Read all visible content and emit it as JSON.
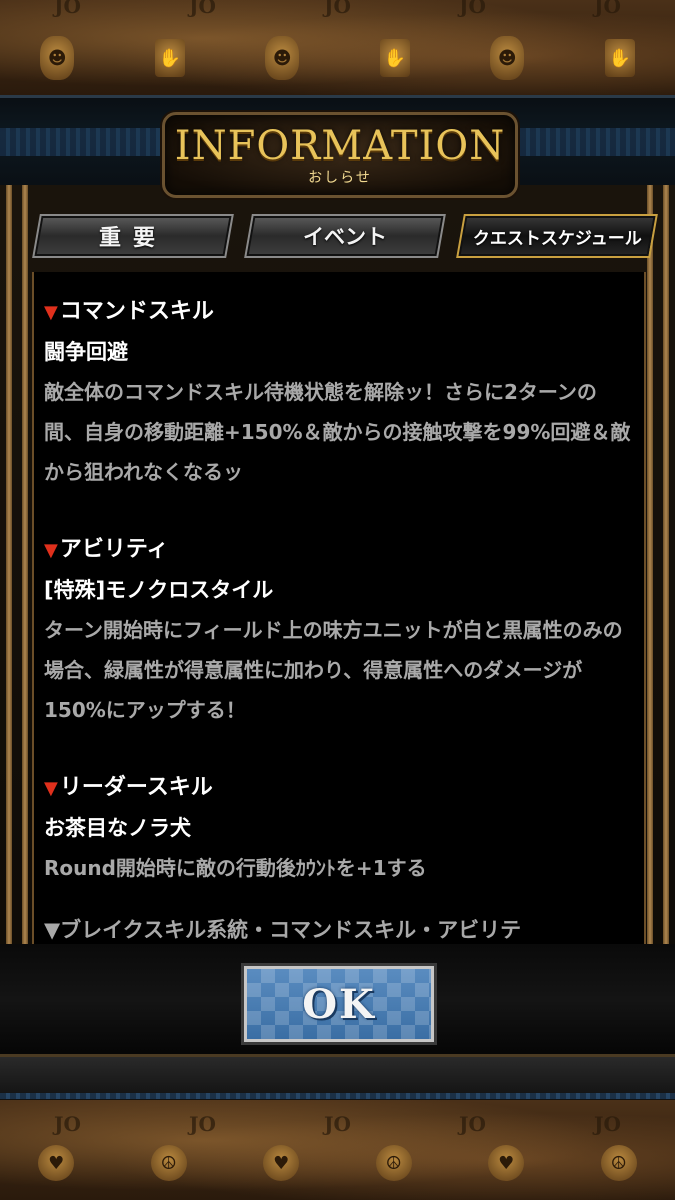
{
  "header": {
    "title": "INFORMATION",
    "subtitle": "おしらせ"
  },
  "decor": {
    "jo_mark": "JO",
    "top_motifs": [
      "mask-icon",
      "hand-icon",
      "mask-icon",
      "hand-icon",
      "mask-icon",
      "hand-icon"
    ],
    "bottom_motifs": [
      "heart-icon",
      "peace-icon",
      "heart-icon",
      "peace-icon",
      "heart-icon",
      "peace-icon"
    ]
  },
  "tabs": [
    {
      "label": "重要"
    },
    {
      "label": "イベント"
    },
    {
      "label": "クエストスケジュール",
      "selected": true
    }
  ],
  "content": {
    "sections": [
      {
        "heading": "コマンドスキル",
        "name": "闘争回避",
        "description": "敵全体のコマンドスキル待機状態を解除ッ！さらに2ターンの間、自身の移動距離+150%＆敵からの接触攻撃を99%回避＆敵から狙われなくなるッ"
      },
      {
        "heading": "アビリティ",
        "name": "[特殊]モノクロスタイル",
        "description": "ターン開始時にフィールド上の味方ユニットが白と黒属性のみの場合、緑属性が得意属性に加わり、得意属性へのダメージが150%にアップする！"
      },
      {
        "heading": "リーダースキル",
        "name": "お茶目なノラ犬",
        "description": "Round開始時に敵の行動後ｶｳﾝﾄを+1する"
      }
    ],
    "cutoff_line": "▼ブレイクスキル系統・コマンドスキル・アビリテ"
  },
  "ok_button": {
    "label": "OK"
  },
  "colors": {
    "heading_marker": "#e0301c",
    "title_gold": "#e8c35a",
    "body_text": "#a9a9a9",
    "ok_blue": "#4a7eb4"
  }
}
